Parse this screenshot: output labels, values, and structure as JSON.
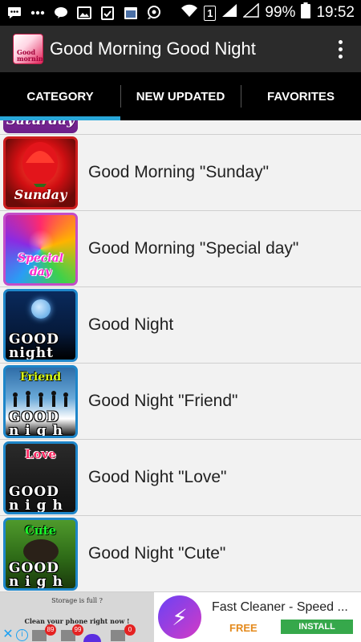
{
  "status_bar": {
    "battery": "99%",
    "time": "19:52",
    "sim_slot": "1",
    "icons": [
      "messages-icon",
      "more-icon",
      "line-icon",
      "gallery-icon",
      "clipboard-icon",
      "calendar-icon",
      "chat-icon",
      "wifi-icon",
      "signal-icon",
      "battery-icon"
    ]
  },
  "app_bar": {
    "title": "Good Morning Good Night",
    "logo_text": "Good\nmorning"
  },
  "tabs": [
    {
      "label": "CATEGORY",
      "active": true
    },
    {
      "label": "NEW UPDATED",
      "active": false
    },
    {
      "label": "FAVORITES",
      "active": false
    }
  ],
  "list": {
    "partial_item": {
      "thumb_text": "Saturday"
    },
    "items": [
      {
        "label": "Good Morning \"Sunday\"",
        "thumb_text": "Sunday"
      },
      {
        "label": "Good Morning \"Special day\"",
        "thumb_text": "Special day"
      },
      {
        "label": "Good Night",
        "thumb_text": "GOOD night"
      },
      {
        "label": "Good Night \"Friend\"",
        "thumb_text": "Friend"
      },
      {
        "label": "Good Night \"Love\"",
        "thumb_text": "Love"
      },
      {
        "label": "Good Night \"Cute\"",
        "thumb_text": "Cute"
      }
    ]
  },
  "ad": {
    "storage_text": "Storage is full ?",
    "clean_text": "Clean your phone right now !",
    "badge_1": "89",
    "badge_2": "99",
    "badge_3": "0",
    "app_name": "Fast Cleaner - Speed ...",
    "price": "FREE",
    "install_label": "INSTALL"
  }
}
